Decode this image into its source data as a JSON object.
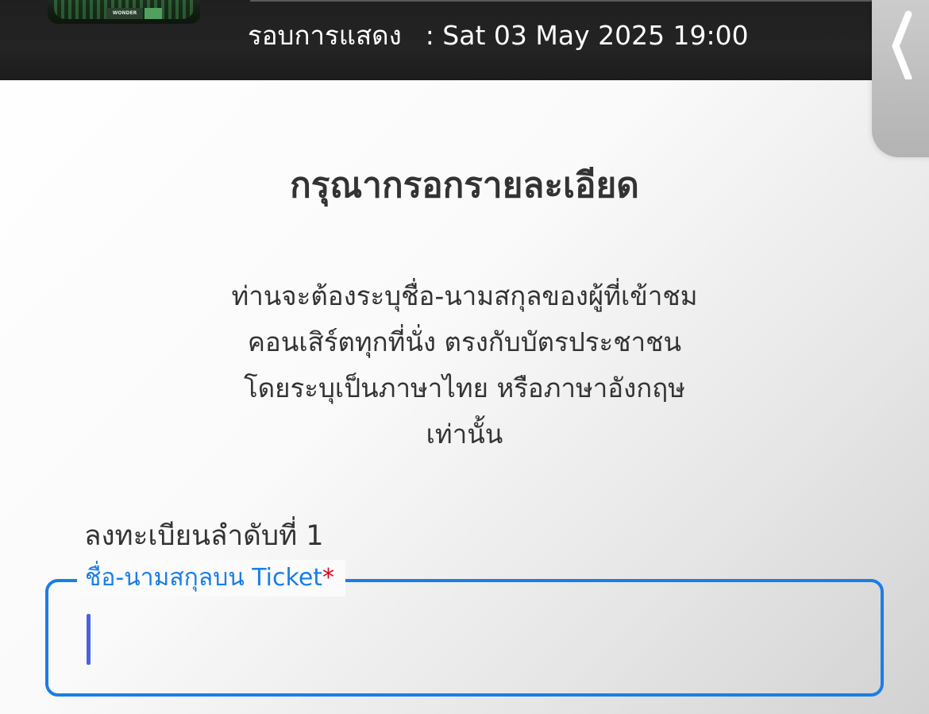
{
  "header": {
    "thumbnail_logo": "WONDER",
    "showtime_label": "รอบการแสดง",
    "showtime_value": ": Sat 03 May 2025 19:00"
  },
  "back_icon": "chevron-left-icon",
  "form": {
    "title": "กรุณากรอกรายละเอียด",
    "description_lines": [
      "ท่านจะต้องระบุชื่อ-นามสกุลของผู้ที่เข้าชม",
      "คอนเสิร์ตทุกที่นั่ง ตรงกับบัตรประชาชน",
      "โดยระบุเป็นภาษาไทย หรือภาษาอังกฤษ",
      "เท่านั้น"
    ],
    "registration_label": "ลงทะเบียนลำดับที่ 1",
    "name_field": {
      "label": "ชื่อ-นามสกุลบน Ticket",
      "required_mark": "*",
      "value": ""
    }
  },
  "colors": {
    "header_bg": "#202020",
    "accent": "#1a7ee6",
    "required": "#d9001b",
    "caret": "#4a62e0",
    "text": "#333333"
  }
}
